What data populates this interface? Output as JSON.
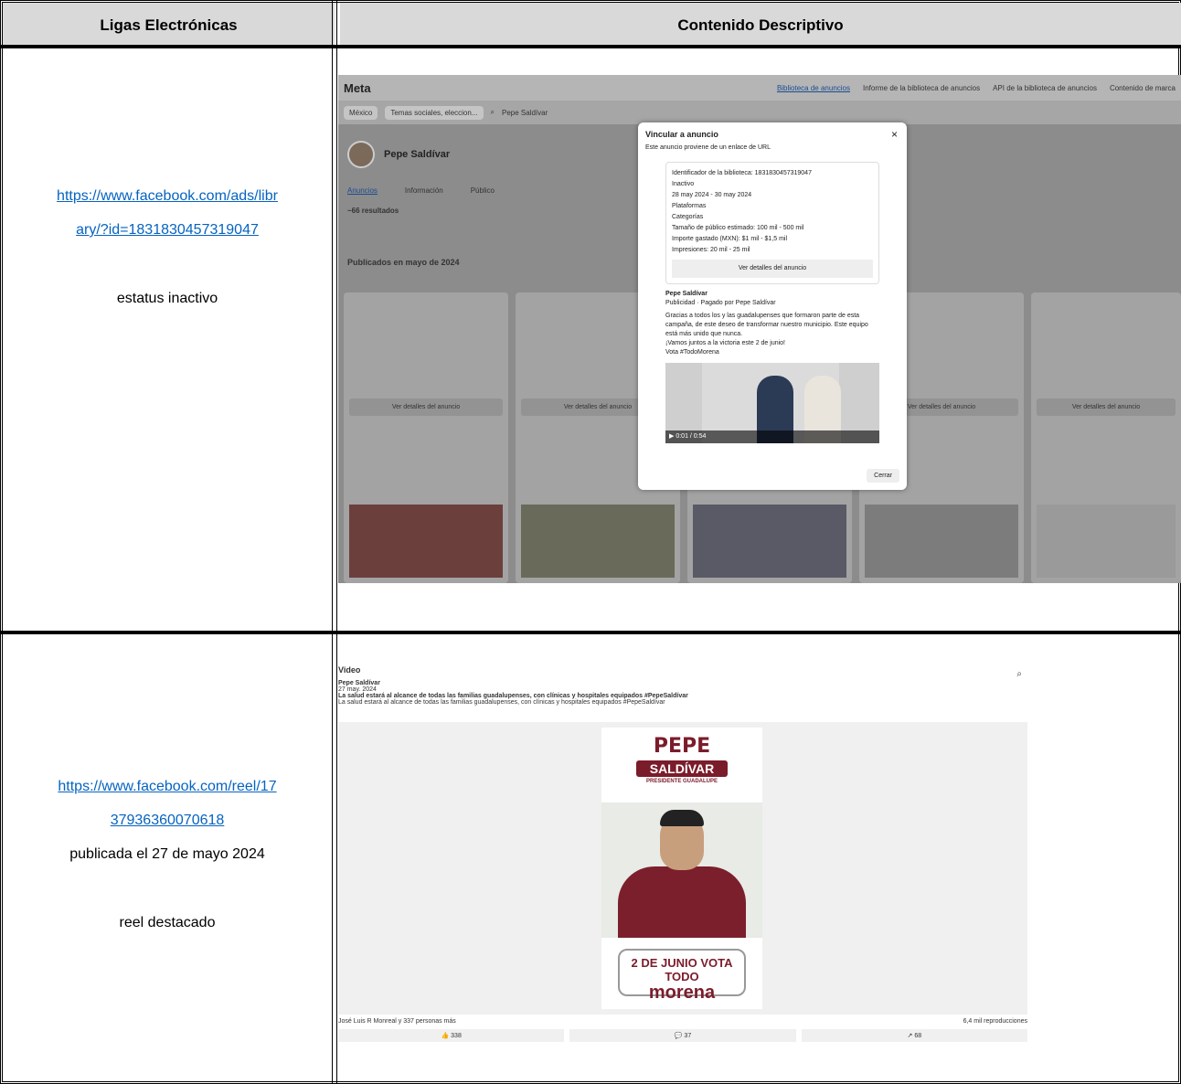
{
  "headers": {
    "left": "Ligas Electrónicas",
    "right": "Contenido Descriptivo"
  },
  "row1": {
    "link_line1": "https://www.facebook.com/ads/libr",
    "link_line2": "ary/?id=1831830457319047",
    "status": "estatus inactivo",
    "screenshot": {
      "logo": "Meta",
      "nav": [
        "Biblioteca de anuncios",
        "Informe de la biblioteca de anuncios",
        "API de la biblioteca de anuncios",
        "Contenido de marca"
      ],
      "country": "México",
      "category": "Temas sociales, eleccion...",
      "search": "Pepe Saldívar",
      "page_name": "Pepe Saldívar",
      "tabs": [
        "Anuncios",
        "Información",
        "Público"
      ],
      "results": "~66 resultados",
      "published": "Publicados en mayo de 2024",
      "modal": {
        "title": "Vincular a anuncio",
        "subtitle": "Este anuncio proviene de un enlace de URL",
        "library_id": "Identificador de la biblioteca: 1831830457319047",
        "status": "Inactivo",
        "dates": "28 may 2024 - 30 may 2024",
        "platforms": "Plataformas",
        "categories": "Categorías",
        "audience": "Tamaño de público estimado: 100 mil - 500 mil",
        "spent": "Importe gastado (MXN): $1 mil - $1,5 mil",
        "impressions": "Impresiones: 20 mil - 25 mil",
        "details_button": "Ver detalles del anuncio",
        "advertiser": "Pepe Saldívar",
        "sponsored": "Publicidad · Pagado por Pepe Saldívar",
        "body": "Gracias a todos los y las guadalupenses que formaron parte de esta campaña, de este deseo de transformar nuestro municipio. Este equipo está más unido que nunca.",
        "body2": "¡Vamos juntos a la victoria este 2 de junio!",
        "body3": "Vota #TodoMorena",
        "video_time": "0:01 / 0:54",
        "close": "Cerrar"
      },
      "card_details": "Ver detalles del anuncio"
    }
  },
  "row2": {
    "link_line1": "https://www.facebook.com/reel/17",
    "link_line2": "37936360070618",
    "date": "publicada el 27 de mayo 2024",
    "note": "reel destacado",
    "screenshot": {
      "title": "Video",
      "author": "Pepe Saldívar",
      "post_date": "27 may. 2024",
      "caption_bold": "La salud estará al alcance de todas las familias guadalupenses, con clínicas y hospitales equipados #PepeSaldívar",
      "caption": "La salud estará al alcance de todas las familias guadalupenses, con clínicas y hospitales equipados #PepeSaldívar",
      "poster_name": "PEPE",
      "poster_surname": "SALDÍVAR",
      "poster_role": "PRESIDENTE GUADALUPE",
      "vote_line1": "2 DE JUNIO  VOTA TODO",
      "vote_line2": "morena",
      "reactions": "José Luis R Monreal y 337 personas más",
      "views": "6,4 mil reproducciones",
      "likes": "338",
      "comments": "37",
      "shares": "68"
    }
  }
}
